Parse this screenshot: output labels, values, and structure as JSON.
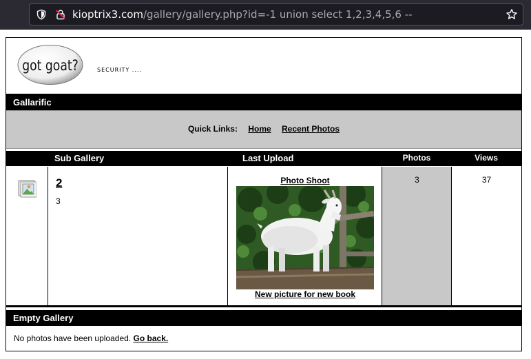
{
  "browser": {
    "url_host": "kioptrix3.com",
    "url_path": "/gallery/gallery.php?id=-1 union select 1,2,3,4,5,6 --"
  },
  "site": {
    "logo_text": "got goat?",
    "tagline": "SECURITY ...."
  },
  "gallery_bar": {
    "title": "Gallarific"
  },
  "quick_links": {
    "label": "Quick Links:",
    "links": [
      "Home",
      "Recent Photos"
    ]
  },
  "table": {
    "headers": {
      "sub_gallery": "Sub Gallery",
      "last_upload": "Last Upload",
      "photos": "Photos",
      "views": "Views"
    },
    "row": {
      "name": "2",
      "count": "3",
      "photo_title": "Photo Shoot",
      "photo_caption": "New picture for new book",
      "photos": "3",
      "views": "37"
    }
  },
  "empty_gallery": {
    "title": "Empty Gallery",
    "message": "No photos have been uploaded.",
    "link": "Go back."
  }
}
